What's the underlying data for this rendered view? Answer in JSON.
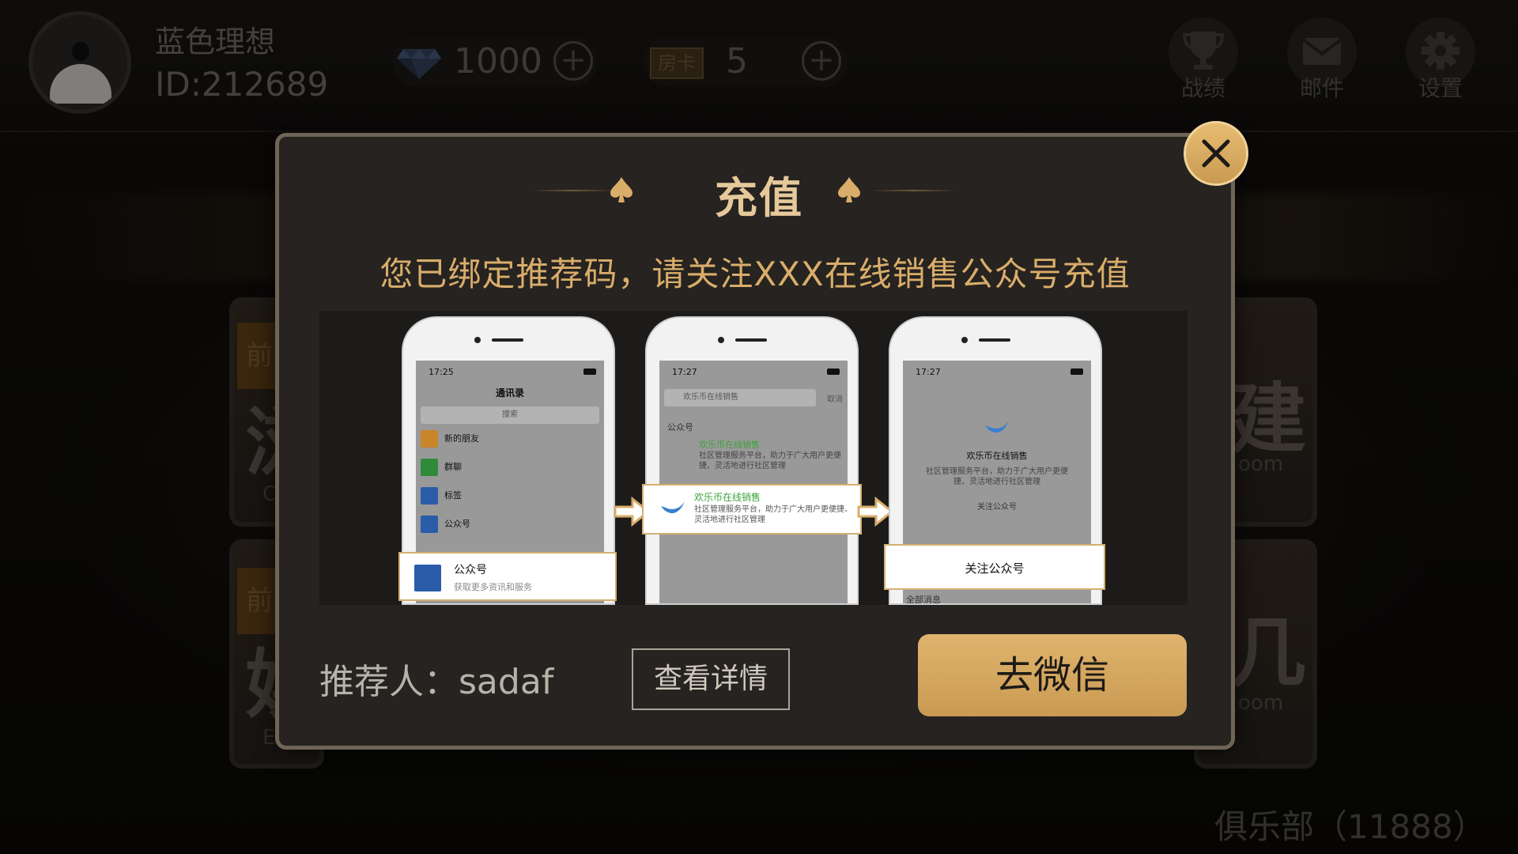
{
  "user": {
    "name": "蓝色理想",
    "id_text": "ID:212689"
  },
  "resources": {
    "diamonds": "1000",
    "room_card_icon": "房卡",
    "room_cards": "5",
    "plus_icon": "+"
  },
  "top_nav": [
    {
      "label": "战绩",
      "icon": "trophy-icon"
    },
    {
      "label": "邮件",
      "icon": "mail-icon"
    },
    {
      "label": "设置",
      "icon": "gear-icon"
    }
  ],
  "background": {
    "cards": [
      {
        "tag": "前",
        "big": "浏",
        "small": "C"
      },
      {
        "tag": "前",
        "big": "娱",
        "small": "E"
      },
      {
        "big": "建",
        "small": "oom"
      },
      {
        "big": "几",
        "small": "oom"
      }
    ],
    "club": "俱乐部（11888）"
  },
  "modal": {
    "title": "充值",
    "notice": "您已绑定推荐码，请关注XXX在线销售公众号充值",
    "guide": {
      "phone1": {
        "time": "17:25",
        "title": "通讯录",
        "search": "搜索",
        "rows": [
          "新的朋友",
          "群聊",
          "标签",
          "公众号"
        ],
        "highlight_title": "公众号",
        "highlight_sub": "获取更多资讯和服务"
      },
      "phone2": {
        "time": "17:27",
        "search_text": "欢乐币在线销售",
        "cancel": "取消",
        "section": "公众号",
        "result_name": "欢乐币在线销售",
        "result_desc": "社区管理服务平台，助力于广大用户更便捷、灵活地进行社区管理"
      },
      "phone3": {
        "time": "17:27",
        "name": "欢乐币在线销售",
        "desc": "社区管理服务平台，助力于广大用户更便捷、灵活地进行社区管理",
        "follow_small": "关注公众号",
        "follow_button": "关注公众号",
        "all_messages": "全部消息"
      }
    },
    "referrer": "推荐人：sadaf",
    "detail_button": "查看详情",
    "wechat_button": "去微信",
    "close_icon": "close-icon"
  },
  "colors": {
    "accent_gold": "#d9ad6a",
    "button_gold": "#c99a52",
    "modal_bg": "#262320"
  }
}
